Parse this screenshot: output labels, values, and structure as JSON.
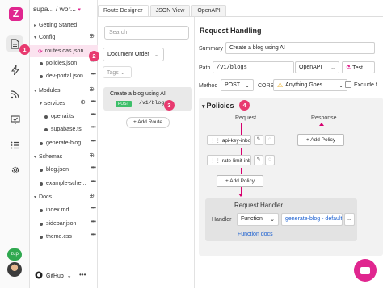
{
  "app": {
    "logo_letter": "Z",
    "accent": "#e0268f"
  },
  "rail": {
    "icons": [
      "file-icon",
      "bolt-icon",
      "rss-icon",
      "check-icon",
      "list-icon",
      "gear-icon"
    ],
    "zup_label": "zup"
  },
  "project": {
    "name": "supa...",
    "separator": "/",
    "branch": "wor...",
    "caret": "▾"
  },
  "tree": [
    {
      "label": "Getting Started"
    },
    {
      "label": "Config"
    },
    {
      "label": "routes.oas.json"
    },
    {
      "label": "policies.json"
    },
    {
      "label": "dev-portal.json"
    },
    {
      "label": "Modules"
    },
    {
      "label": "services"
    },
    {
      "label": "openai.ts"
    },
    {
      "label": "supabase.ts"
    },
    {
      "label": "generate-blog..."
    },
    {
      "label": "Schemas"
    },
    {
      "label": "blog.json"
    },
    {
      "label": "example-sche..."
    },
    {
      "label": "Docs"
    },
    {
      "label": "index.md"
    },
    {
      "label": "sidebar.json"
    },
    {
      "label": "theme.css"
    }
  ],
  "github": {
    "label": "GitHub",
    "caret": "⌄"
  },
  "tabs": [
    "Route Designer",
    "JSON View",
    "OpenAPI"
  ],
  "routes_panel": {
    "search_placeholder": "Search",
    "order_label": "Document Order",
    "tags_label": "Tags",
    "route": {
      "title": "Create a blog using AI",
      "method": "POST",
      "path": "/v1/blogs"
    },
    "add_route": "+ Add Route"
  },
  "request_handling": {
    "title": "Request Handling",
    "summary_label": "Summary",
    "summary_value": "Create a blog using AI",
    "path_label": "Path",
    "path_value": "/v1/blogs",
    "openapi_label": "OpenAPI",
    "test_label": "Test",
    "method_label": "Method",
    "method_value": "POST",
    "cors_label": "CORS",
    "cors_value": "Anything Goes",
    "exclude_label": "Exclude f"
  },
  "policies": {
    "title": "Policies",
    "request_label": "Request",
    "response_label": "Response",
    "items": [
      "api-key-inbou",
      "rate-limit-inbo"
    ],
    "add_policy_request": "+ Add Policy",
    "add_policy_response": "+ Add Policy"
  },
  "request_handler": {
    "title": "Request Handler",
    "handler_label": "Handler",
    "handler_type": "Function",
    "handler_value": "generate-blog - default",
    "docs_link": "Function docs"
  },
  "badges": [
    "1",
    "2",
    "3",
    "4"
  ]
}
